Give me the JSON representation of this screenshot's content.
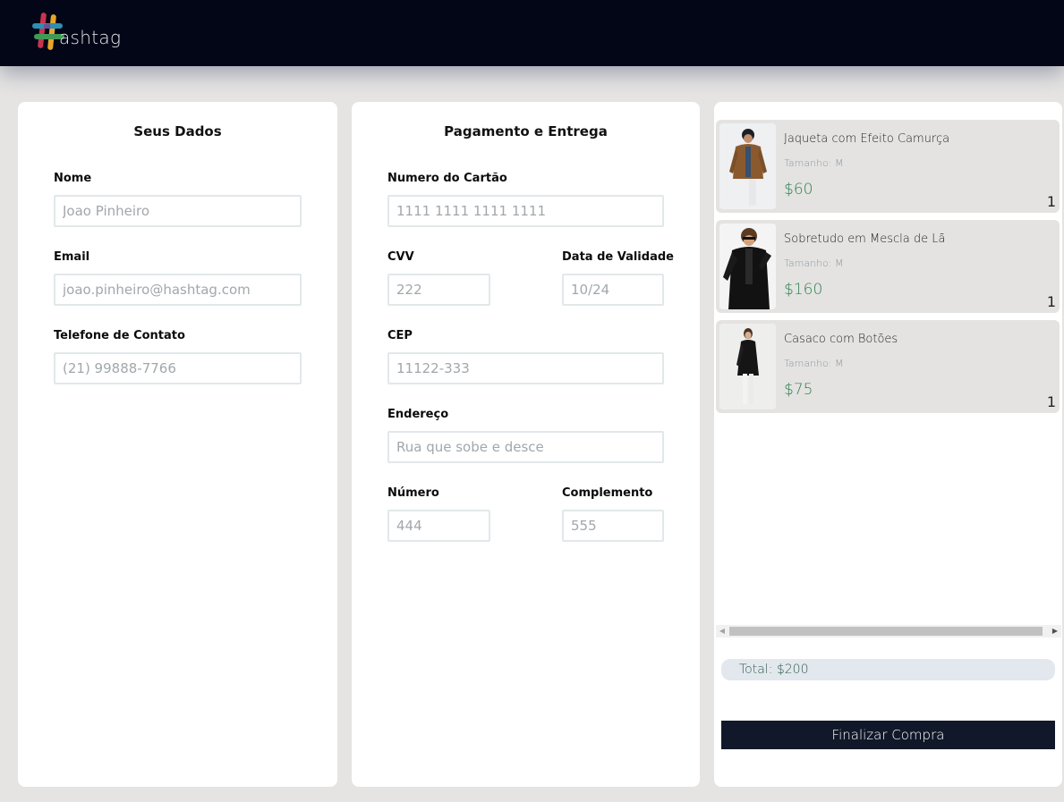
{
  "brand": {
    "logo_text": "ashtag"
  },
  "personal": {
    "title": "Seus Dados",
    "fields": [
      {
        "label": "Nome",
        "placeholder": "Joao Pinheiro"
      },
      {
        "label": "Email",
        "placeholder": "joao.pinheiro@hashtag.com"
      },
      {
        "label": "Telefone de Contato",
        "placeholder": "(21) 99888-7766"
      }
    ]
  },
  "payment": {
    "title": "Pagamento e Entrega",
    "card": {
      "label": "Numero do Cartão",
      "placeholder": "1111 1111 1111 1111"
    },
    "cvv": {
      "label": "CVV",
      "placeholder": "222"
    },
    "expiry": {
      "label": "Data de Validade",
      "placeholder": "10/24"
    },
    "cep": {
      "label": "CEP",
      "placeholder": "11122-333"
    },
    "address": {
      "label": "Endereço",
      "placeholder": "Rua que sobe e desce"
    },
    "number": {
      "label": "Número",
      "placeholder": "444"
    },
    "complement": {
      "label": "Complemento",
      "placeholder": "555"
    }
  },
  "cart": {
    "items": [
      {
        "name": "Jaqueta com Efeito Camurça",
        "size": "Tamanho: M",
        "price": "$60",
        "qty": "1"
      },
      {
        "name": "Sobretudo em Mescla de Lã",
        "size": "Tamanho: M",
        "price": "$160",
        "qty": "1"
      },
      {
        "name": "Casaco com Botões",
        "size": "Tamanho: M",
        "price": "$75",
        "qty": "1"
      }
    ],
    "total": "Total: $200",
    "finalize_label": "Finalizar Compra"
  },
  "colors": {
    "header_bg": "#030617",
    "page_bg": "#e5e4e2",
    "price_green": "#2d8050",
    "button_bg": "#111829"
  }
}
